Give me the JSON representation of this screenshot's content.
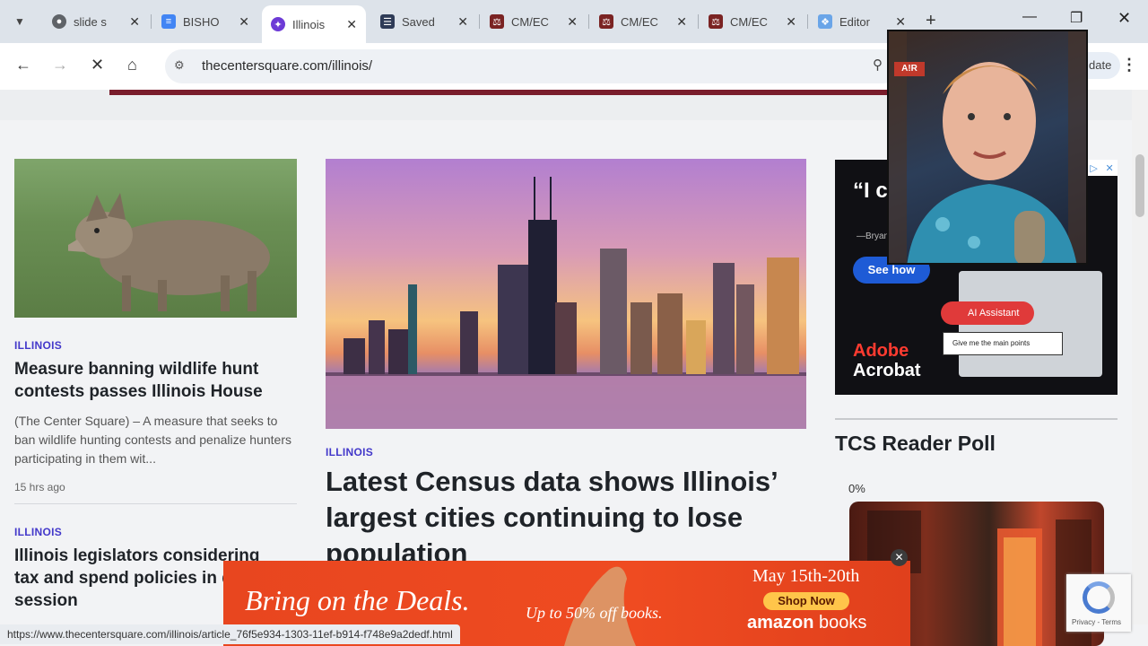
{
  "browser": {
    "tabs": [
      {
        "label": "slide s",
        "icon": "globe-icon"
      },
      {
        "label": "BISHO",
        "icon": "docs-icon"
      },
      {
        "label": "Illinois",
        "icon": "site-icon"
      },
      {
        "label": "Saved",
        "icon": "columns-icon"
      },
      {
        "label": "CM/EC",
        "icon": "scales-icon"
      },
      {
        "label": "CM/EC",
        "icon": "scales-icon"
      },
      {
        "label": "CM/EC",
        "icon": "scales-icon"
      },
      {
        "label": "Editor",
        "icon": "editor-icon"
      }
    ],
    "active_tab_index": 2,
    "url": "thecentersquare.com/illinois/",
    "update_label": "date",
    "status_url": "https://www.thecentersquare.com/illinois/article_76f5e934-1303-11ef-b914-f748e9a2dedf.html"
  },
  "left_column": {
    "article1": {
      "category": "ILLINOIS",
      "headline": "Measure banning wildlife hunt contests passes Illinois House",
      "excerpt": "(The Center Square) – A measure that seeks to ban wildlife hunting contests and penalize hunters participating in them wit...",
      "time": "15 hrs ago"
    },
    "article2": {
      "category": "ILLINOIS",
      "headline": "Illinois legislators considering tax and spend policies in days of session"
    }
  },
  "main_column": {
    "category": "ILLINOIS",
    "headline": "Latest Census data shows Illinois’ largest cities continuing to lose population"
  },
  "ad_acrobat": {
    "quote": "“I c all",
    "attribution": "—Bryan",
    "cta": "See how",
    "assistant_pill": "AI Assistant",
    "input_text": "Give me the main points",
    "brand_line1": "Adobe",
    "brand_line2": "Acrobat"
  },
  "poll": {
    "title": "TCS Reader Poll",
    "percent": "0%"
  },
  "amazon_ad": {
    "tagline": "Bring on the Deals.",
    "offer": "Up to 50% off books.",
    "dates": "May 15th-20th",
    "cta": "Shop Now",
    "brand": "amazon",
    "brand_suffix": "books"
  },
  "recaptcha": {
    "privacy": "Privacy",
    "terms": "Terms"
  },
  "webcam": {
    "logo": "A!R"
  },
  "colors": {
    "category_accent": "#4338ca",
    "header_bar": "#7a1d2c",
    "amazon_orange": "#ef4b21"
  }
}
